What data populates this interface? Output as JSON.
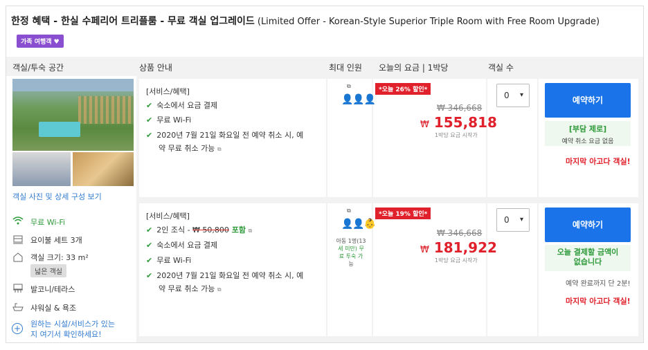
{
  "title": {
    "ko": "한정 혜택 - 한실 수페리어 트리플룸 - 무료 객실 업그레이드",
    "en": " (Limited Offer - Korean-Style Superior Triple Room with Free Room Upgrade)"
  },
  "family_badge": "가족 여행객 ♥",
  "headers": {
    "room": "객실/투숙 공간",
    "product": "상품 안내",
    "max_guests": "최대 인원",
    "today_price": "오늘의 요금 | 1박당",
    "rooms_count": "객실 수"
  },
  "room": {
    "photo_link": "객실 사진 및 상세 구성 보기",
    "amenities": {
      "wifi": "무료 Wi-Fi",
      "bed": "요이불 세트 3개",
      "size": "객실 크기: 33 m²",
      "size_badge": "넓은 객실",
      "balcony": "발코니/테라스",
      "shower": "샤워실 & 욕조",
      "more": [
        "원하는 시설/서비스가 있는",
        "지 여기서 확인하세요!"
      ]
    }
  },
  "offers": [
    {
      "service_header": "[서비스/혜택]",
      "items": [
        "숙소에서 요금 결제",
        "무료 Wi-Fi",
        "2020년 7월 21일 화요일 전 예약 취소 시, 예",
        "약 무료 취소 가능"
      ],
      "discount": "*오늘 26% 할인*",
      "old_price": "₩ 346,668",
      "currency": "₩",
      "new_price": "155,818",
      "per_night": "1박당 요금 시작가",
      "qty": "0",
      "book": "예약하기",
      "green_title": "[부담 제로]",
      "green_sub": "예약 취소 요금 없음",
      "last": "마지막 아고다 객실!"
    },
    {
      "service_header": "[서비스/혜택]",
      "breakfast_prefix": "2인 조식 - ",
      "breakfast_old": "₩ 50,800",
      "breakfast_incl": " 포함",
      "items": [
        "숙소에서 요금 결제",
        "무료 Wi-Fi",
        "2020년 7월 21일 화요일 전 예약 취소 시, 예",
        "약 무료 취소 가능"
      ],
      "child_note": [
        "아동 1명(13",
        "세 미만) 무",
        "료 투숙 가",
        "능"
      ],
      "discount": "*오늘 19% 할인*",
      "old_price": "₩ 346,668",
      "currency": "₩",
      "new_price": "181,922",
      "per_night": "1박당 요금 시작가",
      "qty": "0",
      "book": "예약하기",
      "green_title": [
        "오늘 결제할 금액이",
        "없습니다"
      ],
      "note": "예약 완료까지 단 2분!",
      "last": "마지막 아고다 객실!"
    }
  ],
  "colors": {
    "accent": "#1a73e8",
    "discount": "#e0202a",
    "green": "#2e9a3a",
    "badge": "#8a4fd0"
  }
}
